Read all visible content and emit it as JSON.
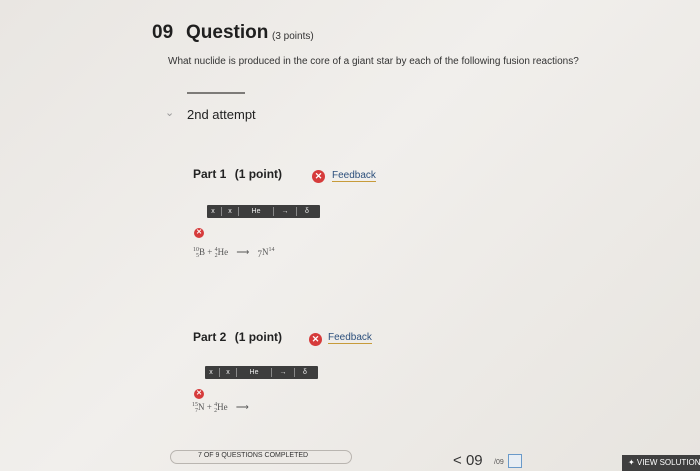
{
  "header": {
    "number": "09",
    "title": "Question",
    "points": "(3 points)",
    "question_text": "What nuclide is produced in the core of a giant star by each of the following fusion reactions?"
  },
  "attempt": {
    "label": "2nd attempt"
  },
  "parts": [
    {
      "label": "Part 1",
      "points": "(1 point)",
      "feedback": "Feedback",
      "toolbar": [
        "x",
        "x",
        "He",
        "→",
        "δ"
      ],
      "equation": {
        "reactant1_mass": "10",
        "reactant1_atomic": "5",
        "reactant1_symbol": "B",
        "plus": "+",
        "reactant2_mass": "4",
        "reactant2_atomic": "2",
        "reactant2_symbol": "He",
        "arrow": "⟶",
        "answer_atomic": "7",
        "answer_symbol": "N",
        "answer_mass": "14"
      }
    },
    {
      "label": "Part 2",
      "points": "(1 point)",
      "feedback": "Feedback",
      "toolbar": [
        "x",
        "x",
        "He",
        "→",
        "δ"
      ],
      "equation": {
        "reactant1_mass": "15",
        "reactant1_atomic": "7",
        "reactant1_symbol": "N",
        "plus": "+",
        "reactant2_mass": "4",
        "reactant2_atomic": "2",
        "reactant2_symbol": "He",
        "arrow": "⟶"
      }
    }
  ],
  "footer": {
    "progress_text": "7 OF 9 QUESTIONS COMPLETED",
    "progress_completed": 7,
    "progress_total": 9,
    "nav_prev": "<",
    "nav_current": "09",
    "nav_total": "/09",
    "view_solution": "✦ VIEW SOLUTION"
  },
  "colors": {
    "error": "#d63b3b",
    "toolbar": "#3d3d3d",
    "link": "#2c4f7c"
  }
}
